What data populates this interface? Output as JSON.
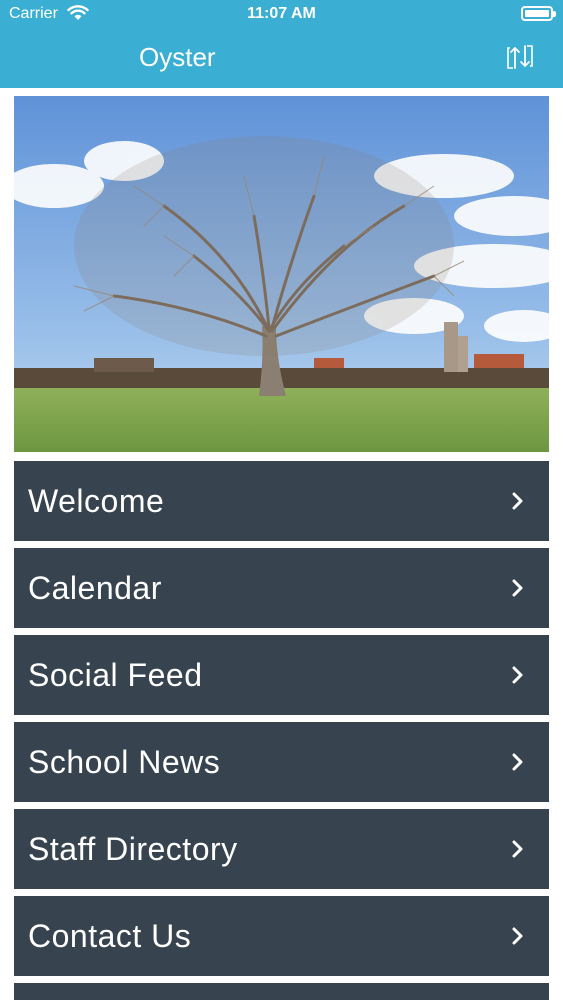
{
  "status_bar": {
    "carrier": "Carrier",
    "time": "11:07 AM",
    "wifi_icon": "wifi-icon",
    "battery_icon": "battery-icon"
  },
  "header": {
    "title": "Oyster",
    "switch_icon": "switch-arrows-icon",
    "background_color": "#3aaed3"
  },
  "hero": {
    "description": "tree-in-field-photo"
  },
  "menu": {
    "background_color": "#37444f",
    "items": [
      {
        "label": "Welcome",
        "icon": "chevron-right-icon"
      },
      {
        "label": "Calendar",
        "icon": "chevron-right-icon"
      },
      {
        "label": "Social Feed",
        "icon": "chevron-right-icon"
      },
      {
        "label": "School News",
        "icon": "chevron-right-icon"
      },
      {
        "label": "Staff Directory",
        "icon": "chevron-right-icon"
      },
      {
        "label": "Contact Us",
        "icon": "chevron-right-icon"
      }
    ]
  }
}
